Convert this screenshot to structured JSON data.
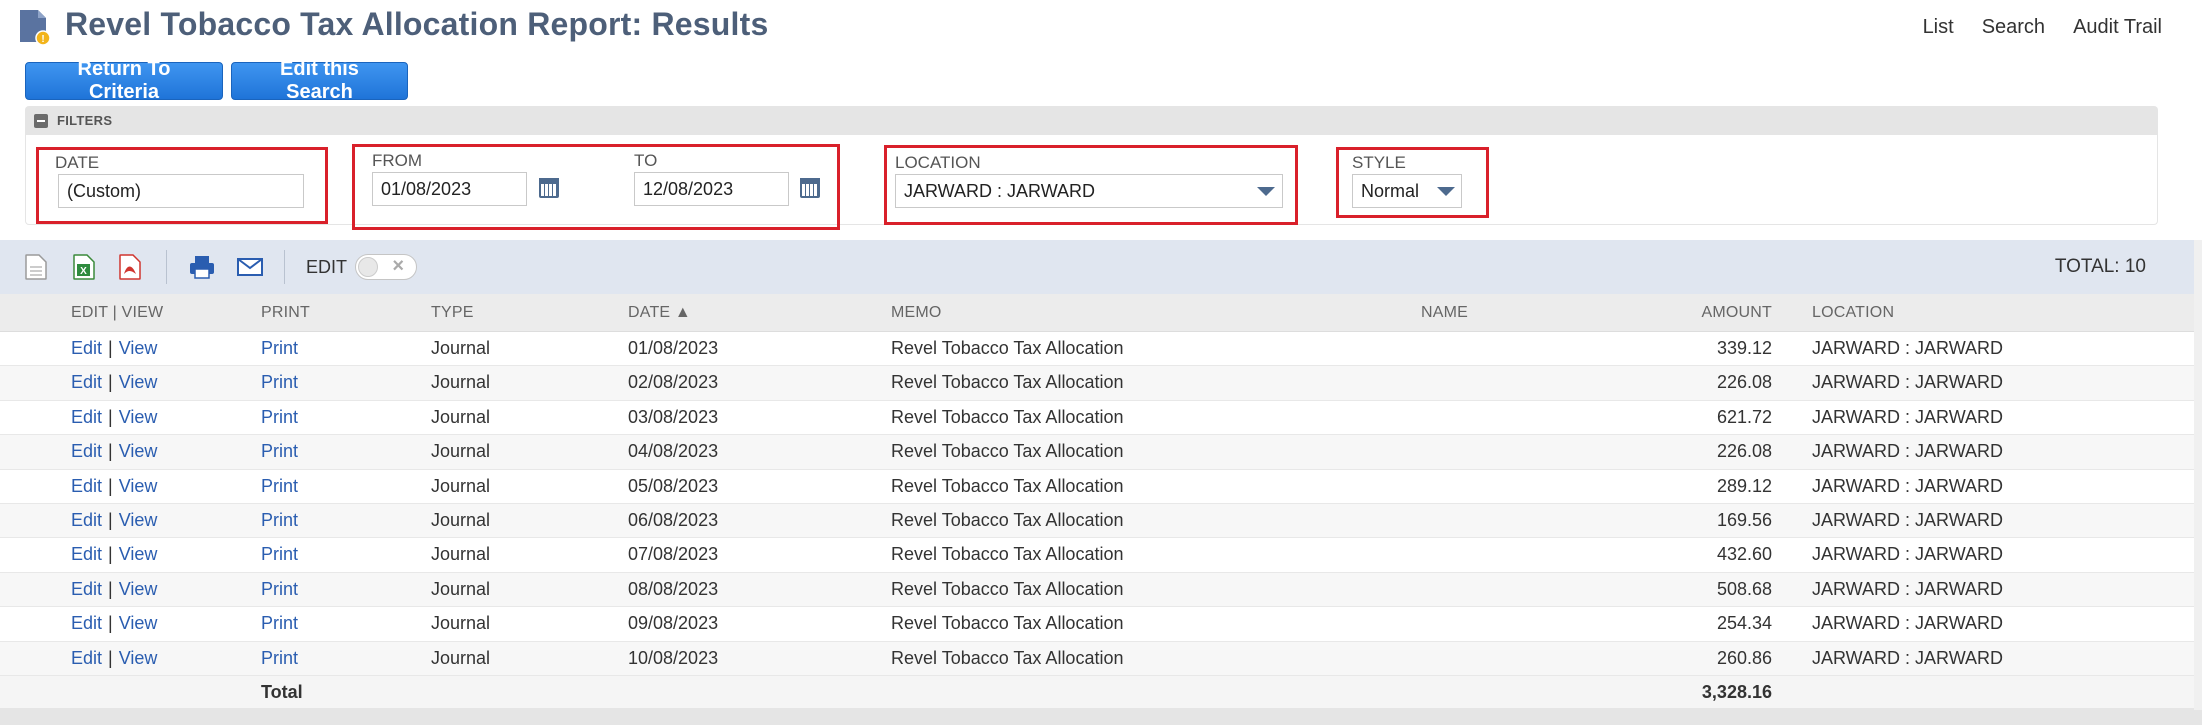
{
  "header": {
    "title": "Revel Tobacco Tax Allocation Report: Results",
    "links": [
      "List",
      "Search",
      "Audit Trail"
    ],
    "icon": "report-document-icon"
  },
  "buttons": {
    "return_label": "Return To Criteria",
    "edit_search_label": "Edit this Search"
  },
  "filters": {
    "section_label": "FILTERS",
    "date": {
      "label": "DATE",
      "value": "(Custom)"
    },
    "from": {
      "label": "FROM",
      "value": "01/08/2023"
    },
    "to": {
      "label": "TO",
      "value": "12/08/2023"
    },
    "location": {
      "label": "LOCATION",
      "value": "JARWARD : JARWARD"
    },
    "style": {
      "label": "STYLE",
      "value": "Normal"
    }
  },
  "toolbar": {
    "edit_label": "EDIT",
    "total_label": "TOTAL: 10",
    "icons": [
      "export-csv-icon",
      "export-excel-icon",
      "export-pdf-icon",
      "print-icon",
      "email-icon"
    ]
  },
  "table": {
    "columns": {
      "edit_view": "EDIT | VIEW",
      "print": "PRINT",
      "type": "TYPE",
      "date": "DATE ▲",
      "memo": "MEMO",
      "name": "NAME",
      "amount": "AMOUNT",
      "location": "LOCATION"
    },
    "edit_link": "Edit",
    "view_link": "View",
    "print_link": "Print",
    "rows": [
      {
        "type": "Journal",
        "date": "01/08/2023",
        "memo": "Revel Tobacco Tax Allocation",
        "name": "",
        "amount": "339.12",
        "location": "JARWARD : JARWARD"
      },
      {
        "type": "Journal",
        "date": "02/08/2023",
        "memo": "Revel Tobacco Tax Allocation",
        "name": "",
        "amount": "226.08",
        "location": "JARWARD : JARWARD"
      },
      {
        "type": "Journal",
        "date": "03/08/2023",
        "memo": "Revel Tobacco Tax Allocation",
        "name": "",
        "amount": "621.72",
        "location": "JARWARD : JARWARD"
      },
      {
        "type": "Journal",
        "date": "04/08/2023",
        "memo": "Revel Tobacco Tax Allocation",
        "name": "",
        "amount": "226.08",
        "location": "JARWARD : JARWARD"
      },
      {
        "type": "Journal",
        "date": "05/08/2023",
        "memo": "Revel Tobacco Tax Allocation",
        "name": "",
        "amount": "289.12",
        "location": "JARWARD : JARWARD"
      },
      {
        "type": "Journal",
        "date": "06/08/2023",
        "memo": "Revel Tobacco Tax Allocation",
        "name": "",
        "amount": "169.56",
        "location": "JARWARD : JARWARD"
      },
      {
        "type": "Journal",
        "date": "07/08/2023",
        "memo": "Revel Tobacco Tax Allocation",
        "name": "",
        "amount": "432.60",
        "location": "JARWARD : JARWARD"
      },
      {
        "type": "Journal",
        "date": "08/08/2023",
        "memo": "Revel Tobacco Tax Allocation",
        "name": "",
        "amount": "508.68",
        "location": "JARWARD : JARWARD"
      },
      {
        "type": "Journal",
        "date": "09/08/2023",
        "memo": "Revel Tobacco Tax Allocation",
        "name": "",
        "amount": "254.34",
        "location": "JARWARD : JARWARD"
      },
      {
        "type": "Journal",
        "date": "10/08/2023",
        "memo": "Revel Tobacco Tax Allocation",
        "name": "",
        "amount": "260.86",
        "location": "JARWARD : JARWARD"
      }
    ],
    "total_label": "Total",
    "total_amount": "3,328.16"
  },
  "colors": {
    "title": "#4d5f79",
    "button": "#1f74d8",
    "link": "#2a5db0",
    "highlight_border": "#d9202a",
    "toolbar_bg": "#e0e6f0"
  }
}
